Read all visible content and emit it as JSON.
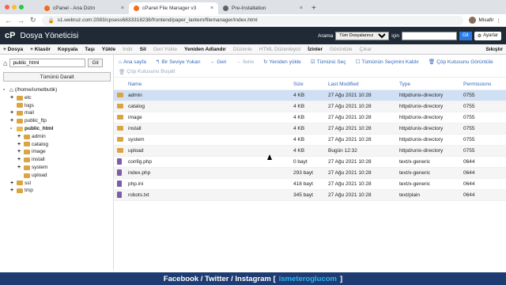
{
  "browser": {
    "tabs": [
      {
        "title": "cPanel - Ana Dizin"
      },
      {
        "title": "cPanel File Manager v3"
      },
      {
        "title": "Pre-Installation"
      }
    ],
    "new_tab": "+",
    "url": "s1.webruz.com:2083/cpsess6833318238/frontend/paper_lantern/filemanager/index.html",
    "user": "Misafir"
  },
  "header": {
    "logo": "cP",
    "title": "Dosya Yöneticisi",
    "search_label": "Arama",
    "search_scope": "Tüm Dosyalarınız",
    "for_label": "için",
    "go": "Git",
    "settings": "Ayarlar"
  },
  "toolbar": [
    "+ Dosya",
    "+ Klasör",
    "Kopyala",
    "Taşı",
    "Yükle",
    "İndir",
    "Sil",
    "Geri Yükle",
    "Yeniden Adlandır",
    "Düzenle",
    "HTML Düzenleyici",
    "İzinler",
    "Görüntüle",
    "Çıkar",
    "Sıkıştır"
  ],
  "toolbar_disabled": [
    false,
    false,
    false,
    false,
    false,
    true,
    false,
    true,
    false,
    true,
    true,
    false,
    true,
    true,
    false
  ],
  "sidebar": {
    "path": "public_html",
    "go": "Git",
    "collapse": "Tümünü Daralt",
    "tree": [
      {
        "label": "(/home/ismetbutik)",
        "level": 0,
        "tog": "-",
        "home": true
      },
      {
        "label": "etc",
        "level": 1,
        "tog": "+"
      },
      {
        "label": "logs",
        "level": 1,
        "tog": ""
      },
      {
        "label": "mail",
        "level": 1,
        "tog": "+"
      },
      {
        "label": "public_ftp",
        "level": 1,
        "tog": "+"
      },
      {
        "label": "public_html",
        "level": 1,
        "tog": "-",
        "bold": true
      },
      {
        "label": "admin",
        "level": 2,
        "tog": "+"
      },
      {
        "label": "catalog",
        "level": 2,
        "tog": "+"
      },
      {
        "label": "image",
        "level": 2,
        "tog": "+"
      },
      {
        "label": "install",
        "level": 2,
        "tog": "+"
      },
      {
        "label": "system",
        "level": 2,
        "tog": "+"
      },
      {
        "label": "upload",
        "level": 2,
        "tog": ""
      },
      {
        "label": "ssl",
        "level": 1,
        "tog": "+"
      },
      {
        "label": "tmp",
        "level": 1,
        "tog": "+"
      }
    ]
  },
  "content_toolbar": [
    {
      "label": "Ana sayfa",
      "dis": false
    },
    {
      "label": "Bir Seviye Yukarı",
      "dis": false
    },
    {
      "label": "Geri",
      "dis": false
    },
    {
      "label": "İlerle",
      "dis": true
    },
    {
      "label": "Yeniden yükle",
      "dis": false
    },
    {
      "label": "Tümünü Seç",
      "dis": false
    },
    {
      "label": "Tümünün Seçimini Kaldır",
      "dis": false
    },
    {
      "label": "Çöp Kutusunu Görüntüle",
      "dis": false
    },
    {
      "label": "Çöp Kutusunu Boşalt",
      "dis": true
    }
  ],
  "columns": [
    "Name",
    "Size",
    "Last Modified",
    "Type",
    "Permissions"
  ],
  "files": [
    {
      "name": "admin",
      "size": "4 KB",
      "date": "27 Ağu 2021 10:28",
      "type": "httpd/unix-directory",
      "perm": "0755",
      "dir": true
    },
    {
      "name": "catalog",
      "size": "4 KB",
      "date": "27 Ağu 2021 10:28",
      "type": "httpd/unix-directory",
      "perm": "0755",
      "dir": true
    },
    {
      "name": "image",
      "size": "4 KB",
      "date": "27 Ağu 2021 10:28",
      "type": "httpd/unix-directory",
      "perm": "0755",
      "dir": true
    },
    {
      "name": "install",
      "size": "4 KB",
      "date": "27 Ağu 2021 10:28",
      "type": "httpd/unix-directory",
      "perm": "0755",
      "dir": true
    },
    {
      "name": "system",
      "size": "4 KB",
      "date": "27 Ağu 2021 10:28",
      "type": "httpd/unix-directory",
      "perm": "0755",
      "dir": true
    },
    {
      "name": "upload",
      "size": "4 KB",
      "date": "Bugün 12:32",
      "type": "httpd/unix-directory",
      "perm": "0755",
      "dir": true
    },
    {
      "name": "config.php",
      "size": "0 bayt",
      "date": "27 Ağu 2021 10:28",
      "type": "text/x-generic",
      "perm": "0644",
      "dir": false
    },
    {
      "name": "index.php",
      "size": "293 bayt",
      "date": "27 Ağu 2021 10:28",
      "type": "text/x-generic",
      "perm": "0644",
      "dir": false
    },
    {
      "name": "php.ini",
      "size": "418 bayt",
      "date": "27 Ağu 2021 10:28",
      "type": "text/x-generic",
      "perm": "0644",
      "dir": false
    },
    {
      "name": "robots.txt",
      "size": "345 bayt",
      "date": "27 Ağu 2021 10:28",
      "type": "text/plain",
      "perm": "0644",
      "dir": false
    }
  ],
  "footer": {
    "text": "Facebook / Twitter / Instagram [",
    "handle": "ismeteroglucom",
    "end": "]"
  }
}
